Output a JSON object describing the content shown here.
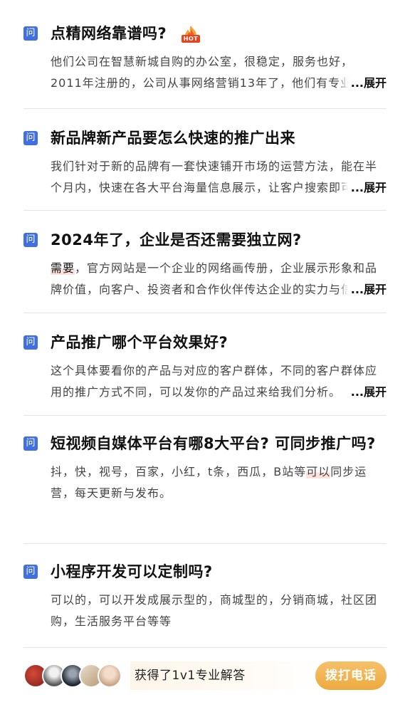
{
  "qa_list": [
    {
      "icon_label": "问",
      "question": "点精网络靠谱吗?",
      "badge": "HOT",
      "answer": "他们公司在智慧新城自购的办公室，很稳定，服务也好，2011年注册的，公司从事网络营销13年了，他们有专业的团队和完善的服务体系。",
      "expand_label": "...展开"
    },
    {
      "icon_label": "问",
      "question": "新品牌新产品要怎么快速的推广出来",
      "answer": "我们针对于新的品牌有一套快速铺开市场的运营方法，能在半个月内，快速在各大平台海量信息展示，让客户搜索即可看到。",
      "expand_label": "...展开"
    },
    {
      "icon_label": "问",
      "question": "2024年了，企业是否还需要独立网?",
      "answer_highlight": "需要",
      "answer": "，官方网站是一个企业的网络画传册，企业展示形象和品牌价值，向客户、投资者和合作伙伴传达企业的实力与信誉。",
      "expand_label": "...展开"
    },
    {
      "icon_label": "问",
      "question": "产品推广哪个平台效果好?",
      "answer": "这个具体要看你的产品与对应的客户群体，不同的客户群体应用的推广方式不同，可以发你的产品过来给我们分析。",
      "expand_label": "...展开"
    },
    {
      "icon_label": "问",
      "question": "短视频自媒体平台有哪8大平台? 可同步推广吗?",
      "answer_pre": "抖，快，视号，百家，小红，t条，西瓜，B站等",
      "answer_highlight": "可以",
      "answer_post": "同步运营，每天更新与发布。"
    },
    {
      "icon_label": "问",
      "question": "小程序开发可以定制吗?",
      "answer": "可以的，可以开发成展示型的，商城型的，分销商城，社区团购，生活服务平台等等"
    }
  ],
  "bottom_bar": {
    "text": "获得了1v1专业解答",
    "call_button": "拨打电话"
  },
  "colors": {
    "question_icon_bg": "#3f6fe0",
    "call_button": "#eda93f",
    "hot_badge": "#f05a28"
  },
  "icons": {
    "question": "question-badge-icon",
    "hot": "hot-flame-icon"
  }
}
